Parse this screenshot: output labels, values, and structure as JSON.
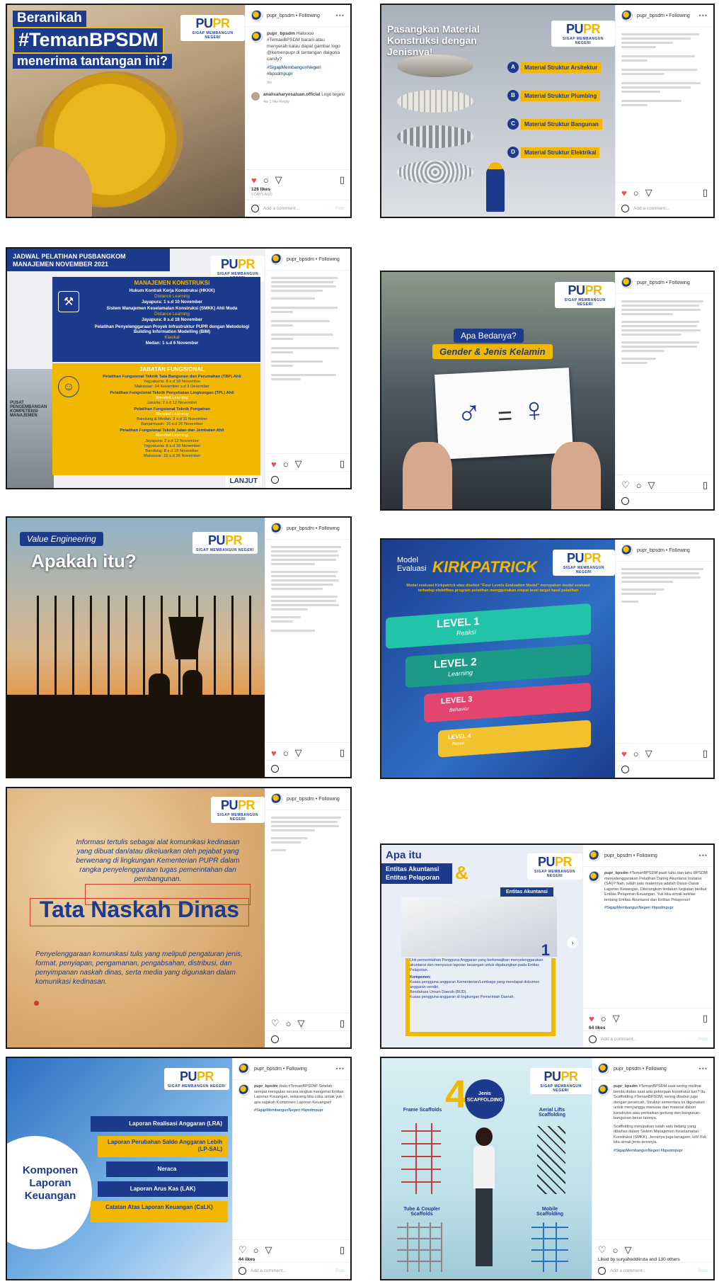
{
  "logo": {
    "text_pu": "PU",
    "text_pr": "PR",
    "tagline": "SIGAP MEMBANGUN NEGERI"
  },
  "post1": {
    "headline1": "Beranikah",
    "headline2": "#TemanBPSDM",
    "headline3": "menerima tantangan ini?",
    "username": "pupr_bpsdm",
    "following": "• Following",
    "caption_user": "pupr_bpsdm",
    "caption": "Haloooo #TemanBPSDM barani atau menyerah kalau dapat gambar logo @kemenpupr di tantangan dalgona candy?",
    "tags": "#SigapMembangunNegeri #bpsdmpupr",
    "cap_time": "9w",
    "comment_user": "analisaharyosaluan.official",
    "comment": "Logo tegesi",
    "comment_meta": "4w  1 like  Reply",
    "likes": "128 likes",
    "ago": "9 DAYS AGO",
    "add_comment": "Add a comment...",
    "post": "Post"
  },
  "post2": {
    "title": "Pasangkan Material Konstruksi dengan Jenisnya!",
    "options": [
      "Material Struktur Arsitektur",
      "Material Struktur Plumbing",
      "Material Struktur Bangunan",
      "Material Struktur Elektrikal"
    ],
    "letters": [
      "A",
      "B",
      "C",
      "D"
    ],
    "username": "pupr_bpsdm • Following"
  },
  "post3": {
    "title": "JADWAL PELATIHAN PUSBANGKOM MANAJEMEN NOVEMBER 2021",
    "section1": "MANAJEMEN KONSTRUKSI",
    "items1": [
      "Hukum Kontrak Kerja Konstruksi (HKKK)",
      "Distance Learning",
      "Jayapura: 1 s.d 10 November",
      "Sistem Manajemen Keselamatan Konstruksi (SMKK) Ahli Muda",
      "Distance Learning",
      "Jayapura: 8 s.d 18 November",
      "Pelatihan Penyelenggaraan Proyek Infrastruktur PUPR dengan Metodologi Building Information Modelling (BIM)",
      "Klasikal",
      "Medan: 1 s.d 6 November"
    ],
    "section2": "JABATAN FUNGSIONAL",
    "items2": [
      "Pelatihan Fungsional Teknik Tata Bangunan dan Perumahan (TBP) Ahli",
      "Yogyakarta: 8 s.d 18 November",
      "Makassar: 24 November s.d 3 Desember",
      "Pelatihan Fungsional Teknik Penyehatan Lingkungan (TPL) Ahli",
      "Blended Learning",
      "Jakarta: 2 s.d 12 November",
      "Pelatihan Fungsional Teknik Pengairan",
      "Blended Learning",
      "Bandung & Medan: 2 s.d 11 November",
      "Banjarmasin: 16 s.d 26 November",
      "Pelatihan Fungsional Teknik Jalan dan Jembatan Ahli",
      "Blended Learning",
      "Jayapura: 2 s.d 12 November",
      "Yogyakarta: 8 s.d 18 November",
      "Bandung: 8 s.d 18 November",
      "Makassar: 15 s.d 26 November"
    ],
    "next": "LANJUT",
    "building": "PUSAT PENGEMBANGAN KOMPETENSI MANAJEMEN"
  },
  "post4": {
    "line1": "Apa Bedanya?",
    "line2": "Gender & Jenis Kelamin"
  },
  "post5": {
    "label": "Value Engineering",
    "title": "Apakah itu?"
  },
  "post6": {
    "pre": "Model Evaluasi",
    "title": "KIRKPATRICK",
    "subtitle": "Model evaluasi Kirkpatrick atau disebut \"Four Levels Evaluation Model\" merupakan model evaluasi terhadap efektifitas program pelatihan menggunakan empat level target hasil pelatihan",
    "levels": [
      {
        "name": "LEVEL 1",
        "sub": "Reaksi"
      },
      {
        "name": "LEVEL 2",
        "sub": "Learning"
      },
      {
        "name": "LEVEL 3",
        "sub": "Behavior"
      },
      {
        "name": "LEVEL 4",
        "sub": "Result"
      }
    ]
  },
  "post7": {
    "intro": "Informasi tertulis sebagai alat komunikasi kedinasan yang dibuat dan/atau dikeluarkan oleh pejabat yang berwenang di lingkungan Kementerian PUPR dalam rangka penyelenggaraan tugas pemerintahan dan pembangunan.",
    "title": "Tata Naskah Dinas",
    "body": "Penyelenggaraan komunikasi tulis yang meliputi pengaturan jenis, format, penyiapan, pengamanan, pengabsahan, distribusi, dan penyimpanan naskah dinas, serta media yang digunakan dalam komunikasi kedinasan."
  },
  "post8": {
    "pre": "Apa itu",
    "l1": "Entitas Akuntansi",
    "l2": "Entitas Pelaporan",
    "amp": "&",
    "tab": "Entitas Akuntansi",
    "num": "1",
    "desc": "Unit pemerintahan Pengguna Anggaran yang berkewajiban menyelenggarakan akuntansi dan menyusun laporan keuangan untuk digabungkan pada Entitas Pelaporan.",
    "komponen": "Komponen:",
    "items": [
      "Kuasa pengguna anggaran Kementerian/Lembaga yang mendapat dokumen anggaran sendiri.",
      "Bendahara Umum Daerah (BUD).",
      "Kuasa pengguna anggaran di lingkungan Pemerintah Daerah."
    ],
    "username": "pupr_bpsdm • Following",
    "caption_user": "pupr_bpsdm",
    "caption": "#TemanBPSDM pasti tahu dan tahu BPSDM menyelenggarakan Pelatihan Daring Akuntansi Instansi (SAI)? Nah, salah satu materinya adalah Dasar-Dasar Laporan Keuangan. Diterangkan tindakan kegiatan berikut Entitas Pelaporan Keuangan. Yuk kita simak sekilas tentang Entitas Akuntansi dan Entitas Pelaporan!",
    "tags": "#SigapMembangunNegeri #bpsdmpupr",
    "likes": "64 likes",
    "add_comment": "Add a comment...",
    "post": "Post"
  },
  "post9": {
    "title_l1": "Komponen",
    "title_l2": "Laporan",
    "title_l3": "Keuangan",
    "items": [
      "Laporan Realisasi Anggaran (LRA)",
      "Laporan Perubahan Saldo Anggaran Lebih (LP-SAL)",
      "Neraca",
      "Laporan Arus Kas (LAK)",
      "Catatan Atas Laporan Keuangan (CaLK)"
    ],
    "username": "pupr_bpsdm • Following",
    "caption_user": "pupr_bpsdm",
    "caption": "Halo #TemanBPSDM! Setelah sempat mengulas secara singkat mengenai Entitas Laporan Keuangan, sekarang kita coba simak yuk apa sajakah Komponen Laporan Keuangan!",
    "tags": "#SigapMembangunNegeri #bpsdmpupr",
    "likes": "44 likes",
    "add_comment": "Add a comment...",
    "post": "Post"
  },
  "post10": {
    "num": "4",
    "label1": "Jenis",
    "label2": "SCAFFOLDING",
    "types": [
      "Frame Scaffolds",
      "Aerial Lifts Scaffolding",
      "Tube & Coupler Scaffolds",
      "Mobile Scaffolding"
    ],
    "username": "pupr_bpsdm • Following",
    "caption_user": "pupr_bpsdm",
    "caption": "#TemanBPSDM saat sering melihat benda diatas saat ada pekerjaan konstruksi kan? Itu Scaffolding #TemanBPSDM, sering disebut juga dengan perancah. Struktur sementara ini digunakan untuk menyangga manusia dan material dalam konstruksi atau perbaikan gedung dan bangunan-bangunan besar lainnya.",
    "caption2": "Scaffolding merupakan salah satu bidang yang dibahas dalam Sistem Manajemen Keselamatan Konstruksi (SMKK). Jenisnya juga beragam, loh! Yuk kita simak jenis-jenisnya.",
    "tags": "#SigapMembangunNegeri #bpsdmpupr",
    "liked_by": "Liked by suryaheddiiruta and 130 others",
    "add_comment": "Add a comment...",
    "post": "Post"
  },
  "small_username": "pupr_bpsdm • Following",
  "small_add": "Add a comment..."
}
